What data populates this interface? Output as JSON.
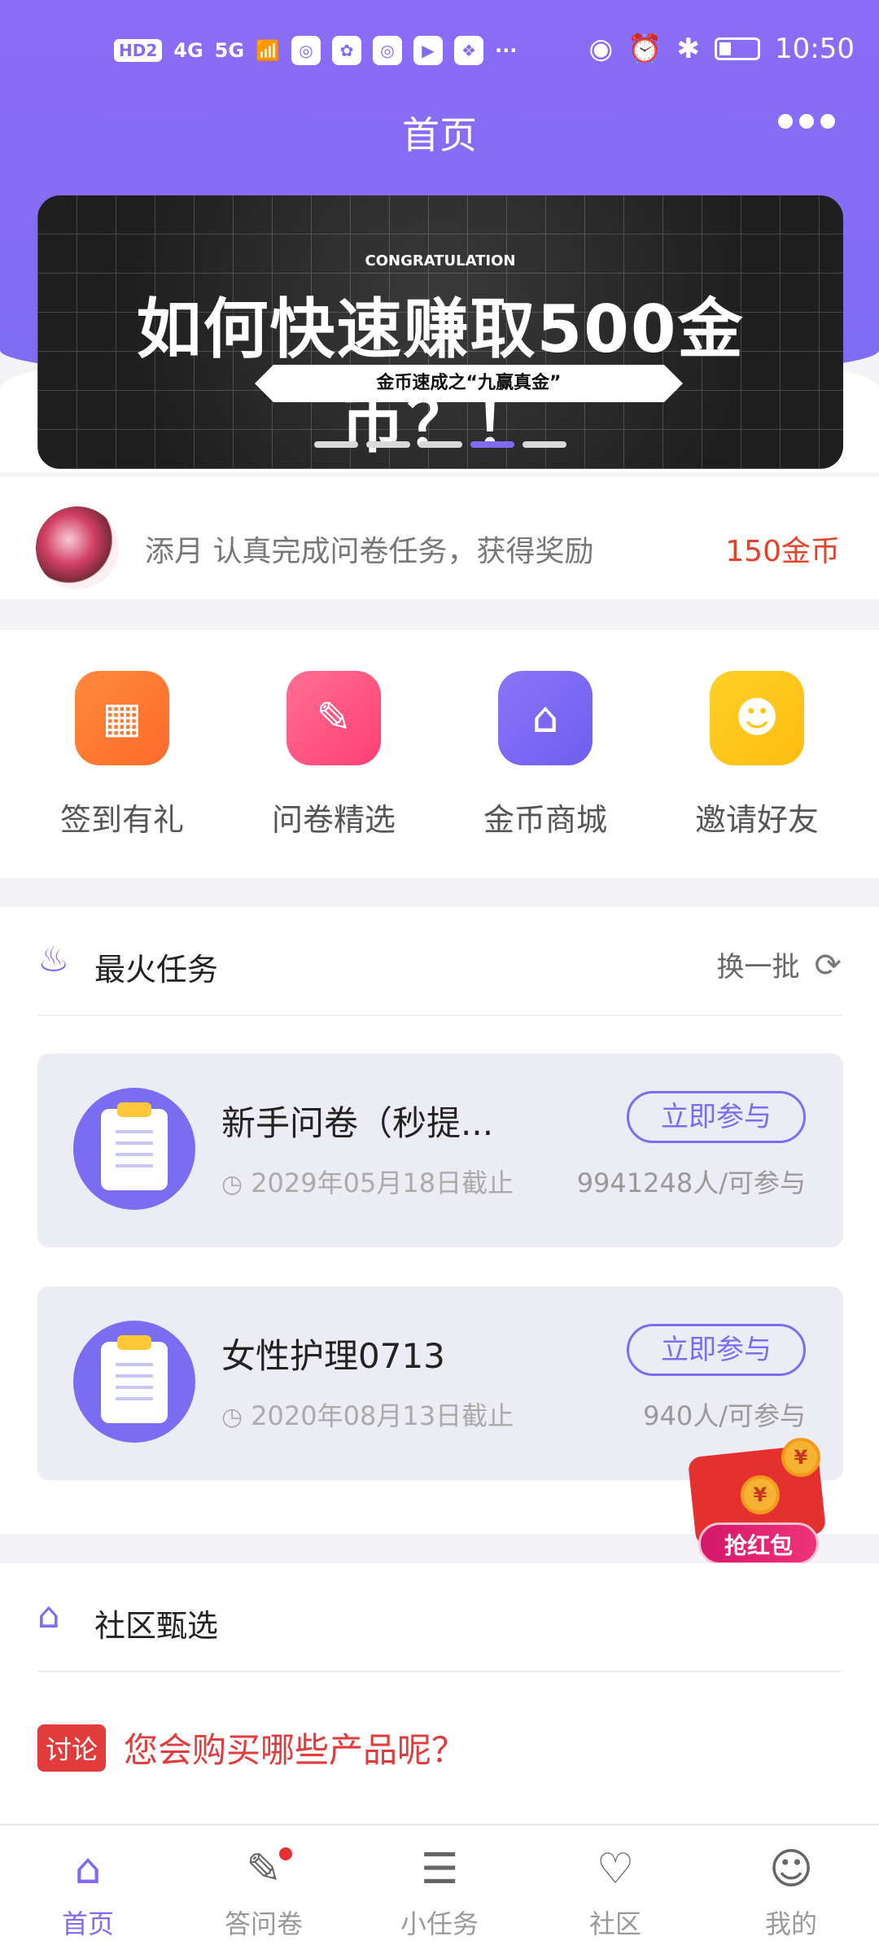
{
  "status_bar": {
    "left_items": [
      "HD2",
      "4G",
      "5G",
      "WiFi"
    ],
    "time": "10:50",
    "more": "···"
  },
  "nav": {
    "title": "首页"
  },
  "banner": {
    "kicker": "CONGRATULATION",
    "headline": "如何快速赚取500金币？！",
    "ribbon": "金币速成之“九赢真金”",
    "active_index": 3,
    "slide_count": 5
  },
  "announcement": {
    "text": "添月 认真完成问卷任务，获得奖励",
    "reward": "150金币"
  },
  "quick_entries": [
    {
      "label": "签到有礼",
      "icon": "calendar-check-icon",
      "color_from": "#ff8a3d",
      "color_to": "#ff6a2a"
    },
    {
      "label": "问卷精选",
      "icon": "certificate-icon",
      "color_from": "#ff6f95",
      "color_to": "#ff3f74"
    },
    {
      "label": "金币商城",
      "icon": "store-icon",
      "color_from": "#8c74f6",
      "color_to": "#6f5ef2"
    },
    {
      "label": "邀请好友",
      "icon": "users-icon",
      "color_from": "#ffd028",
      "color_to": "#ffbc10"
    }
  ],
  "hot_tasks": {
    "title": "最火任务",
    "refresh_label": "换一批",
    "items": [
      {
        "title": "新手问卷（秒提...",
        "deadline": "2029年05月18日截止",
        "count": "9941248人/可参与",
        "button": "立即参与"
      },
      {
        "title": "女性护理0713",
        "deadline": "2020年08月13日截止",
        "count": "940人/可参与",
        "button": "立即参与"
      }
    ]
  },
  "red_packet": {
    "label": "抢红包",
    "coin": "¥"
  },
  "community": {
    "title": "社区甄选",
    "topic_tag": "讨论",
    "topic_text": "您会购买哪些产品呢？"
  },
  "tabbar": {
    "items": [
      {
        "label": "首页",
        "icon": "home-icon",
        "active": true
      },
      {
        "label": "答问卷",
        "icon": "survey-edit-icon",
        "active": false,
        "badge": true
      },
      {
        "label": "小任务",
        "icon": "task-list-icon",
        "active": false
      },
      {
        "label": "社区",
        "icon": "community-heart-icon",
        "active": false
      },
      {
        "label": "我的",
        "icon": "profile-icon",
        "active": false
      }
    ]
  },
  "colors": {
    "brand": "#7f6cf3",
    "accent_red": "#e23b3b",
    "reward_red": "#e2432a"
  }
}
